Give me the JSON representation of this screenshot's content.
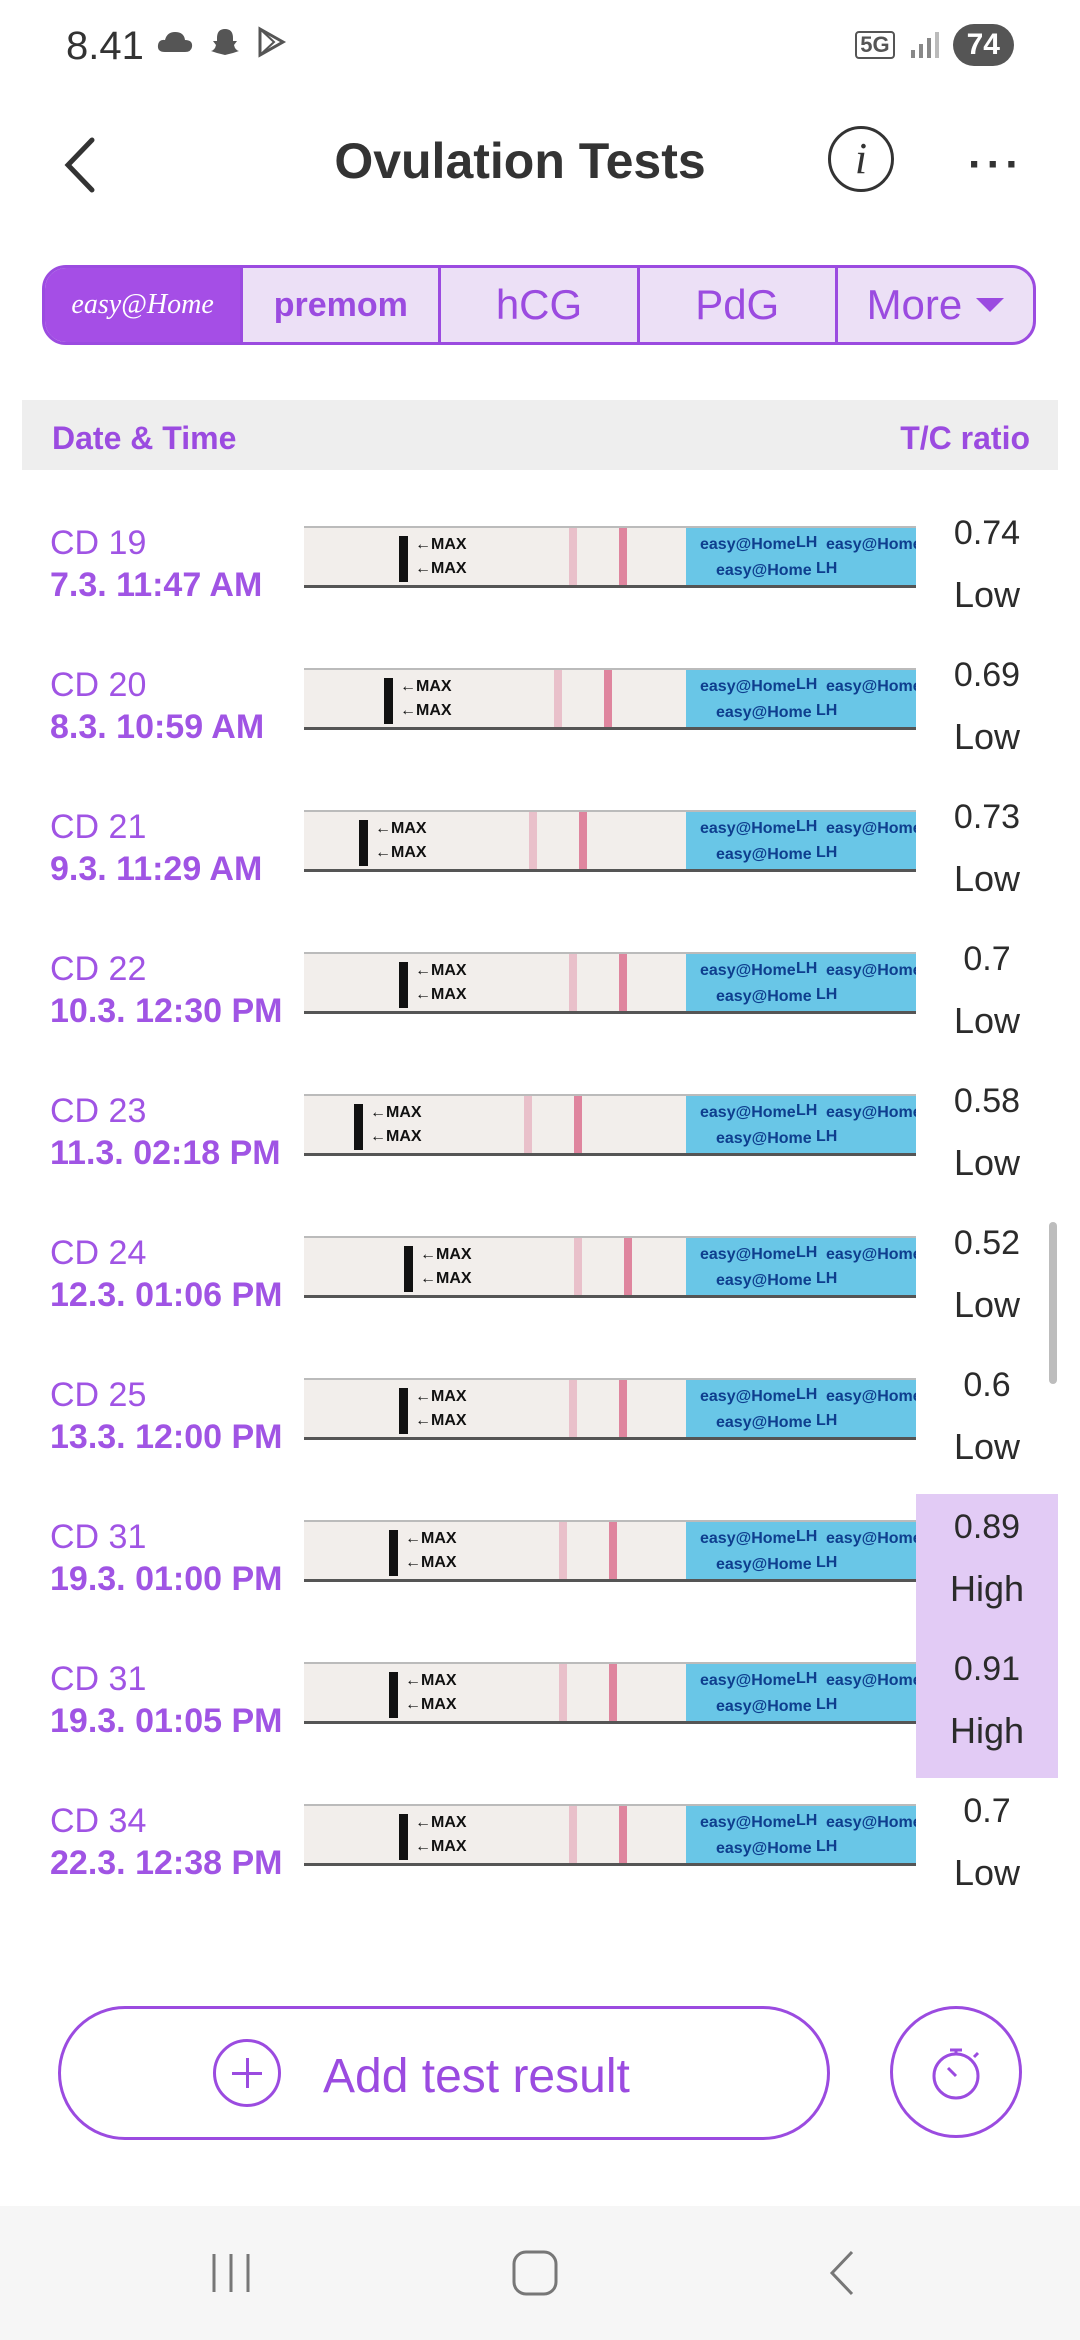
{
  "status_bar": {
    "time": "8.41",
    "icons_left": [
      "cloud-icon",
      "snapchat-icon",
      "play-store-icon"
    ],
    "network": "5G",
    "battery": "74"
  },
  "header": {
    "title": "Ovulation Tests",
    "info_icon": "i",
    "more_icon": "···"
  },
  "tabs": [
    {
      "label": "easy@Home",
      "active": true
    },
    {
      "label": "premom"
    },
    {
      "label": "hCG"
    },
    {
      "label": "PdG"
    },
    {
      "label": "More"
    }
  ],
  "table": {
    "col_left": "Date & Time",
    "col_right": "T/C ratio",
    "rows": [
      {
        "cd": "CD 19",
        "datetime": "7.3.  11:47 AM",
        "ratio": "0.74",
        "level": "Low"
      },
      {
        "cd": "CD 20",
        "datetime": "8.3.  10:59 AM",
        "ratio": "0.69",
        "level": "Low"
      },
      {
        "cd": "CD 21",
        "datetime": "9.3.  11:29 AM",
        "ratio": "0.73",
        "level": "Low"
      },
      {
        "cd": "CD 22",
        "datetime": "10.3.  12:30 PM",
        "ratio": "0.7",
        "level": "Low"
      },
      {
        "cd": "CD 23",
        "datetime": "11.3.  02:18 PM",
        "ratio": "0.58",
        "level": "Low"
      },
      {
        "cd": "CD 24",
        "datetime": "12.3.  01:06 PM",
        "ratio": "0.52",
        "level": "Low"
      },
      {
        "cd": "CD 25",
        "datetime": "13.3.  12:00 PM",
        "ratio": "0.6",
        "level": "Low"
      },
      {
        "cd": "CD 31",
        "datetime": "19.3.  01:00 PM",
        "ratio": "0.89",
        "level": "High"
      },
      {
        "cd": "CD 31",
        "datetime": "19.3.  01:05 PM",
        "ratio": "0.91",
        "level": "High"
      },
      {
        "cd": "CD 34",
        "datetime": "22.3.  12:38 PM",
        "ratio": "0.7",
        "level": "Low"
      }
    ],
    "strip_text": {
      "max": "←MAX",
      "brand": "easy@Home",
      "lh": "LH"
    }
  },
  "actions": {
    "add_label": "Add test result"
  },
  "colors": {
    "accent": "#9b4be0",
    "highlight": "#e2cbf5",
    "strip_blue": "#69c6e7"
  }
}
